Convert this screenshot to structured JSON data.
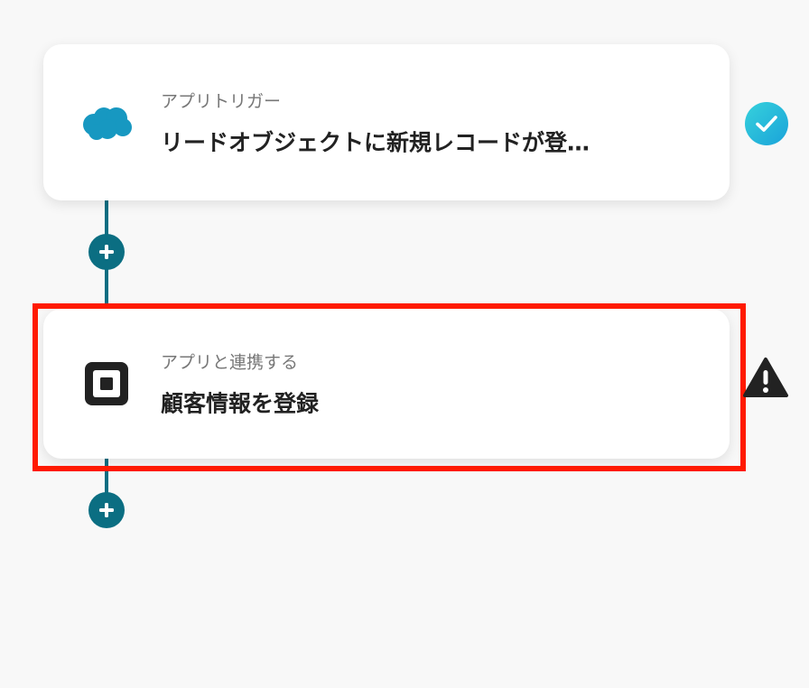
{
  "steps": [
    {
      "kind": "アプリトリガー",
      "title": "リードオブジェクトに新規レコードが登…",
      "app_icon": "salesforce-cloud-icon",
      "status": "completed",
      "status_icon": "check-circle-icon"
    },
    {
      "kind": "アプリと連携する",
      "title": "顧客情報を登録",
      "app_icon": "square-logo-icon",
      "status": "warning",
      "status_icon": "warning-triangle-icon",
      "highlighted": true
    }
  ],
  "colors": {
    "connector": "#0b6e82",
    "check_gradient_start": "#36d1dc",
    "check_gradient_end": "#1aa3d9",
    "salesforce_blue": "#1798c1",
    "highlight_border": "#ff1a00",
    "warning": "#222222"
  }
}
